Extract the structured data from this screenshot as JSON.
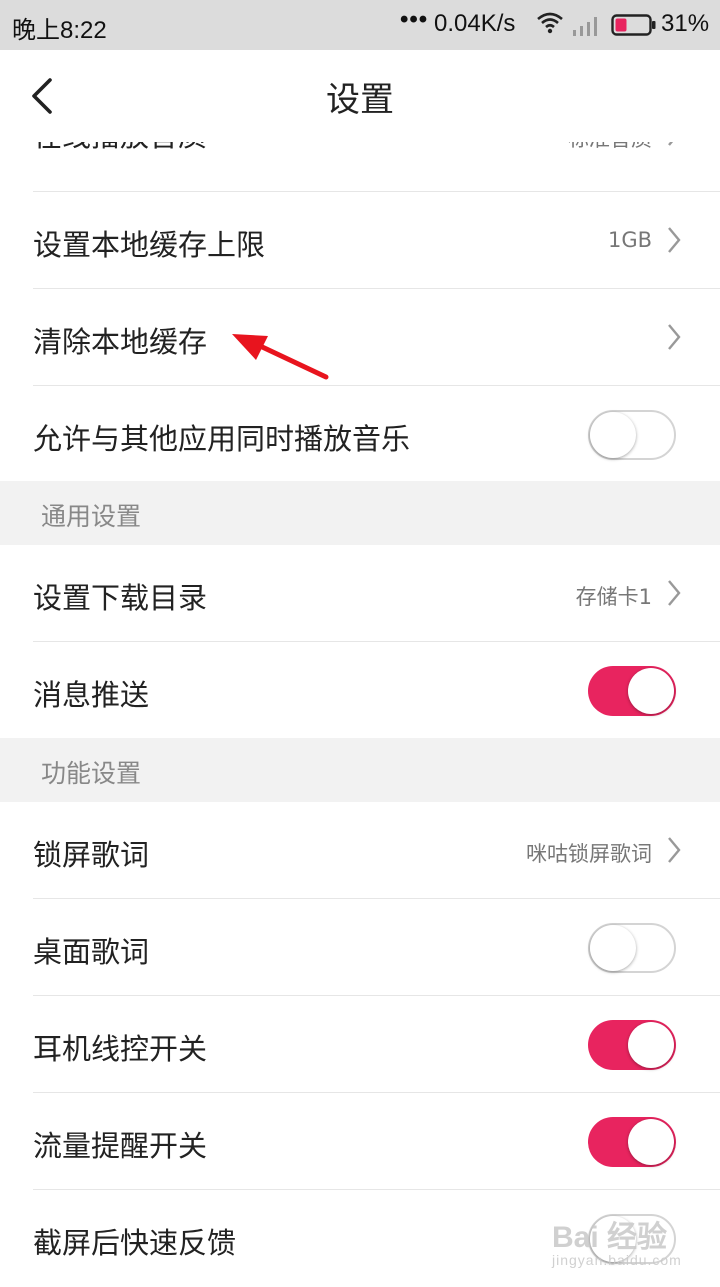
{
  "status_bar": {
    "time": "晚上8:22",
    "dots": "•••",
    "speed": "0.04K/s",
    "battery_pct": "31%",
    "icons": [
      "wifi-icon",
      "signal-icon",
      "battery-icon"
    ]
  },
  "header": {
    "title": "设置",
    "back_icon": "chevron-left-icon"
  },
  "rows_top": [
    {
      "label": "在线播放音质",
      "value": "标准音质"
    },
    {
      "label": "设置本地缓存上限",
      "value": "1GB"
    },
    {
      "label": "清除本地缓存",
      "value": ""
    },
    {
      "label": "允许与其他应用同时播放音乐",
      "toggle": false
    }
  ],
  "section_general": {
    "title": "通用设置",
    "rows": [
      {
        "label": "设置下载目录",
        "value": "存储卡1"
      },
      {
        "label": "消息推送",
        "toggle": true
      }
    ]
  },
  "section_function": {
    "title": "功能设置",
    "rows": [
      {
        "label": "锁屏歌词",
        "value": "咪咕锁屏歌词"
      },
      {
        "label": "桌面歌词",
        "toggle": false
      },
      {
        "label": "耳机线控开关",
        "toggle": true
      },
      {
        "label": "流量提醒开关",
        "toggle": true
      },
      {
        "label": "截屏后快速反馈",
        "toggle": false
      }
    ]
  },
  "watermark": {
    "main": "Bai 经验",
    "sub": "jingyan.baidu.com"
  },
  "colors": {
    "accent": "#e8245f",
    "section_bg": "#f2f2f2",
    "status_bg": "#dcdcdc",
    "annotation_arrow": "#e8141e"
  }
}
